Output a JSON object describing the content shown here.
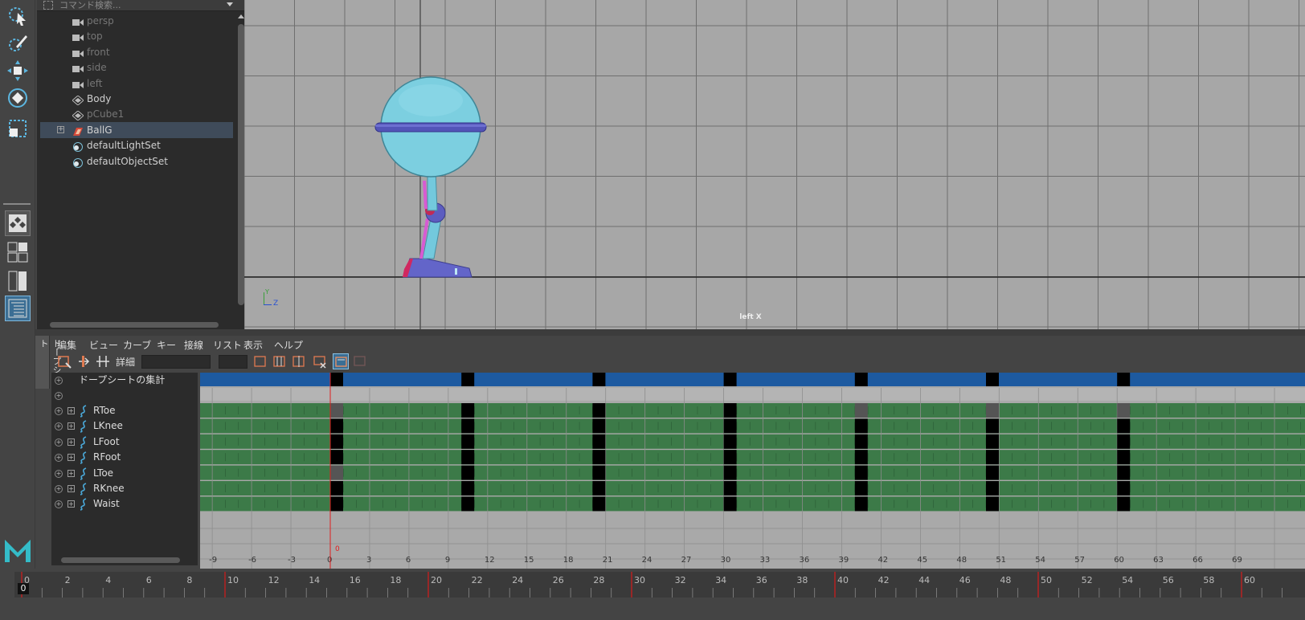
{
  "outliner": {
    "search_placeholder": "コマンド検索...",
    "items": [
      {
        "label": "persp",
        "icon": "camera-icon",
        "dim": true
      },
      {
        "label": "top",
        "icon": "camera-icon",
        "dim": true
      },
      {
        "label": "front",
        "icon": "camera-icon",
        "dim": true
      },
      {
        "label": "side",
        "icon": "camera-icon",
        "dim": true
      },
      {
        "label": "left",
        "icon": "camera-icon",
        "dim": true
      },
      {
        "label": "Body",
        "icon": "mesh-icon",
        "dim": false
      },
      {
        "label": "pCube1",
        "icon": "mesh-icon",
        "dim": true
      },
      {
        "label": "BallG",
        "icon": "group-icon",
        "dim": false,
        "selected": true,
        "expandable": true
      },
      {
        "label": "defaultLightSet",
        "icon": "set-icon",
        "dim": false
      },
      {
        "label": "defaultObjectSet",
        "icon": "set-icon",
        "dim": false
      }
    ]
  },
  "viewport": {
    "camera_label": "left X",
    "axis_y": "Y",
    "axis_z": "Z",
    "colors": {
      "bg": "#a7a7a7",
      "grid": "#6f6f6f",
      "ball": "#79c9dc",
      "ring": "#5657b6"
    }
  },
  "dopesheet": {
    "tab_label": "ドープシート",
    "menus": [
      "編集",
      "ビュー",
      "カーブ",
      "キー",
      "接線",
      "リスト",
      "表示",
      "ヘルプ"
    ],
    "detail_label": "詳細",
    "summary_label": "ドープシートの集計",
    "channels": [
      "RToe",
      "LKnee",
      "LFoot",
      "RFoot",
      "LToe",
      "RKnee",
      "Waist"
    ],
    "ruler_ticks": [
      "-9",
      "-6",
      "-3",
      "0",
      "3",
      "6",
      "9",
      "12",
      "15",
      "18",
      "21",
      "24",
      "27",
      "30",
      "33",
      "36",
      "39",
      "42",
      "45",
      "48",
      "51",
      "54",
      "57",
      "60",
      "63",
      "66",
      "69"
    ],
    "current_frame": "0",
    "colors": {
      "summary": "#1d5aa0",
      "channel": "#3c7a48",
      "key": "#000000",
      "cursor": "#e02020"
    }
  },
  "timeslider": {
    "ticks": [
      "0",
      "2",
      "4",
      "6",
      "8",
      "10",
      "12",
      "14",
      "16",
      "18",
      "20",
      "22",
      "24",
      "26",
      "28",
      "30",
      "32",
      "34",
      "36",
      "38",
      "40",
      "42",
      "44",
      "46",
      "48",
      "50",
      "52",
      "54",
      "56",
      "58",
      "60"
    ],
    "current_frame": "0"
  },
  "logo": "M"
}
